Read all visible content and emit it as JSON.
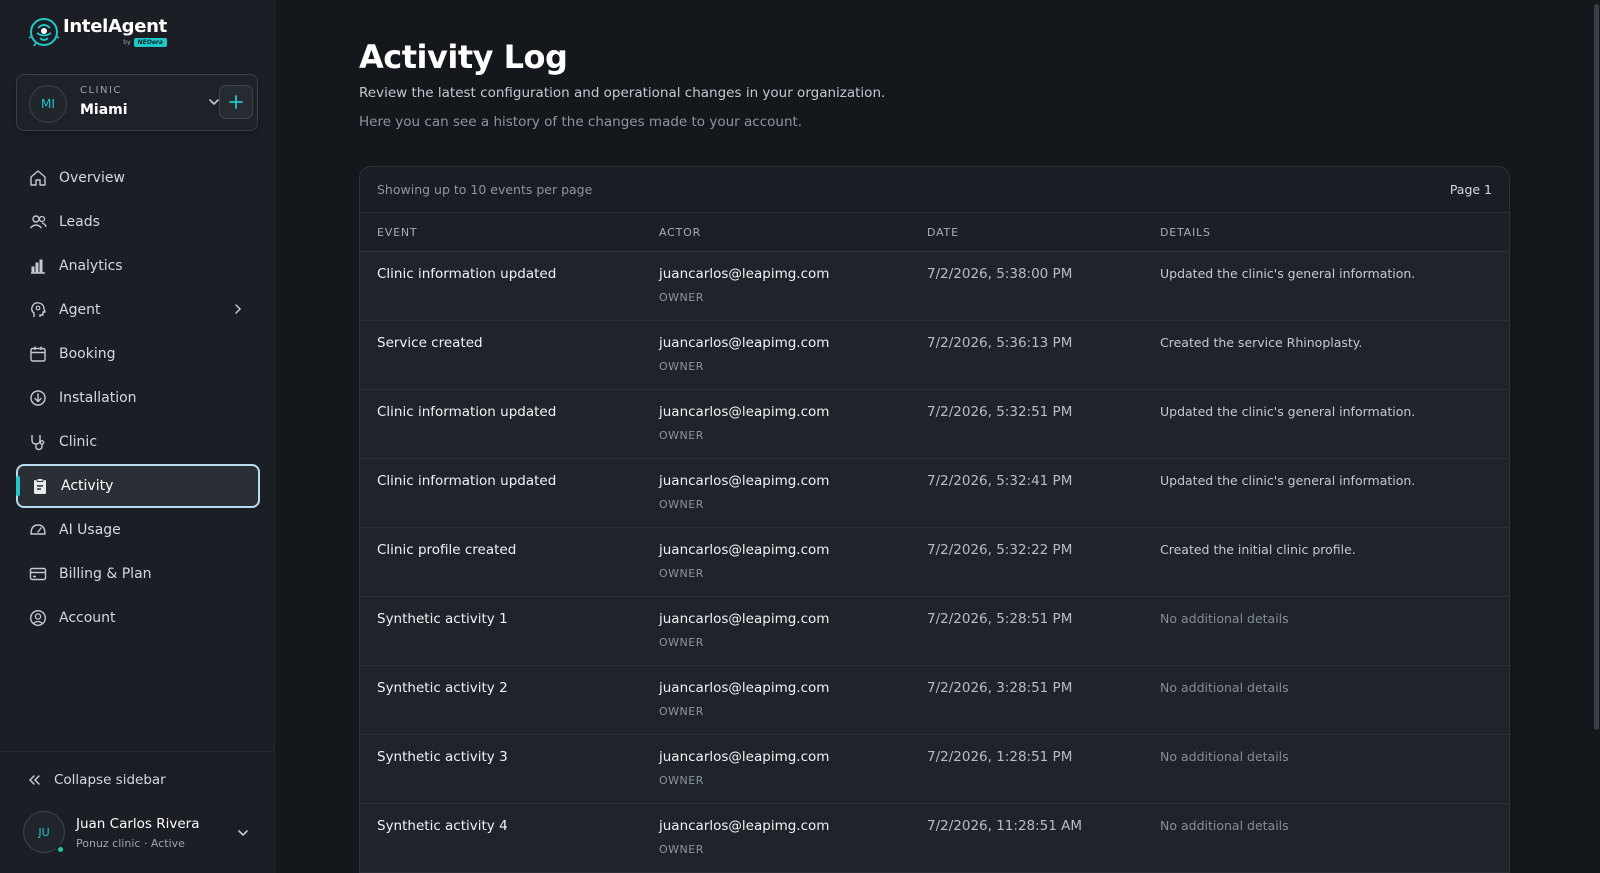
{
  "app": {
    "logo_name": "IntelAgent",
    "logo_by": "by",
    "logo_brand": "NEOera",
    "accent": "#22c7c9"
  },
  "clinic_switcher": {
    "initials": "MI",
    "caption": "CLINIC",
    "name": "Miami"
  },
  "sidebar": {
    "items": [
      {
        "label": "Overview",
        "icon": "home-icon"
      },
      {
        "label": "Leads",
        "icon": "users-icon"
      },
      {
        "label": "Analytics",
        "icon": "bar-chart-icon"
      },
      {
        "label": "Agent",
        "icon": "agent-head-icon"
      },
      {
        "label": "Booking",
        "icon": "calendar-icon"
      },
      {
        "label": "Installation",
        "icon": "download-circle-icon"
      },
      {
        "label": "Clinic",
        "icon": "stethoscope-icon"
      },
      {
        "label": "Activity",
        "icon": "clipboard-icon",
        "active": true
      },
      {
        "label": "AI Usage",
        "icon": "gauge-icon"
      },
      {
        "label": "Billing & Plan",
        "icon": "card-icon"
      },
      {
        "label": "Account",
        "icon": "account-circle-icon"
      }
    ],
    "collapse_label": "Collapse sidebar"
  },
  "user": {
    "initials": "JU",
    "name": "Juan Carlos Rivera",
    "subtitle": "Ponuz clinic · Active",
    "status_color": "#22c7a0"
  },
  "page": {
    "title": "Activity Log",
    "subtitle": "Review the latest configuration and operational changes in your organization.",
    "description": "Here you can see a history of the changes made to your account."
  },
  "table": {
    "showing": "Showing up to 10 events per page",
    "page_label": "Page 1",
    "columns": [
      "EVENT",
      "ACTOR",
      "DATE",
      "DETAILS"
    ],
    "rows": [
      {
        "event": "Clinic information updated",
        "actor": "juancarlos@leapimg.com",
        "role": "OWNER",
        "date": "7/2/2026, 5:38:00 PM",
        "details": "Updated the clinic's general information."
      },
      {
        "event": "Service created",
        "actor": "juancarlos@leapimg.com",
        "role": "OWNER",
        "date": "7/2/2026, 5:36:13 PM",
        "details": "Created the service Rhinoplasty."
      },
      {
        "event": "Clinic information updated",
        "actor": "juancarlos@leapimg.com",
        "role": "OWNER",
        "date": "7/2/2026, 5:32:51 PM",
        "details": "Updated the clinic's general information."
      },
      {
        "event": "Clinic information updated",
        "actor": "juancarlos@leapimg.com",
        "role": "OWNER",
        "date": "7/2/2026, 5:32:41 PM",
        "details": "Updated the clinic's general information."
      },
      {
        "event": "Clinic profile created",
        "actor": "juancarlos@leapimg.com",
        "role": "OWNER",
        "date": "7/2/2026, 5:32:22 PM",
        "details": "Created the initial clinic profile."
      },
      {
        "event": "Synthetic activity 1",
        "actor": "juancarlos@leapimg.com",
        "role": "OWNER",
        "date": "7/2/2026, 5:28:51 PM",
        "details": "No additional details"
      },
      {
        "event": "Synthetic activity 2",
        "actor": "juancarlos@leapimg.com",
        "role": "OWNER",
        "date": "7/2/2026, 3:28:51 PM",
        "details": "No additional details"
      },
      {
        "event": "Synthetic activity 3",
        "actor": "juancarlos@leapimg.com",
        "role": "OWNER",
        "date": "7/2/2026, 1:28:51 PM",
        "details": "No additional details"
      },
      {
        "event": "Synthetic activity 4",
        "actor": "juancarlos@leapimg.com",
        "role": "OWNER",
        "date": "7/2/2026, 11:28:51 AM",
        "details": "No additional details"
      }
    ]
  }
}
